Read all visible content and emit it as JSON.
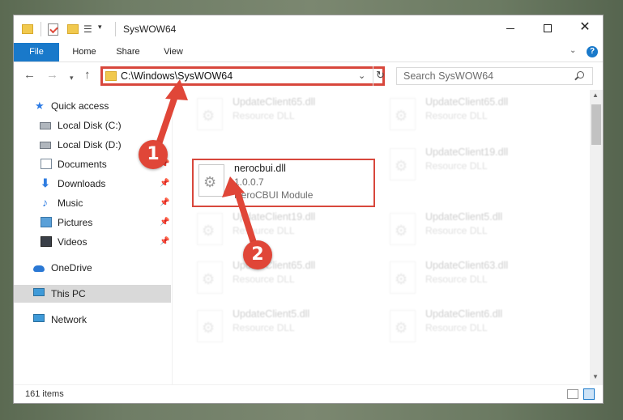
{
  "window": {
    "title": "SysWOW64",
    "controls": {
      "minimize": "minimize",
      "maximize": "maximize",
      "close": "✕"
    }
  },
  "ribbon": {
    "tabs": [
      "File",
      "Home",
      "Share",
      "View"
    ],
    "chevron": "⌄",
    "help": "?"
  },
  "nav": {
    "address": "C:\\Windows\\SysWOW64",
    "search_placeholder": "Search SysWOW64",
    "refresh": "↻",
    "dropdown": "⌄"
  },
  "sidebar": {
    "items": [
      {
        "label": "Quick access",
        "icon": "star-icon",
        "pinned": false
      },
      {
        "label": "Local Disk (C:)",
        "icon": "disk-icon",
        "pinned": false
      },
      {
        "label": "Local Disk (D:)",
        "icon": "disk-icon",
        "pinned": false
      },
      {
        "label": "Documents",
        "icon": "documents-icon",
        "pinned": true
      },
      {
        "label": "Downloads",
        "icon": "downloads-icon",
        "pinned": true
      },
      {
        "label": "Music",
        "icon": "music-icon",
        "pinned": true
      },
      {
        "label": "Pictures",
        "icon": "pictures-icon",
        "pinned": true
      },
      {
        "label": "Videos",
        "icon": "videos-icon",
        "pinned": true
      },
      {
        "label": "OneDrive",
        "icon": "onedrive-icon",
        "pinned": false
      },
      {
        "label": "This PC",
        "icon": "this-pc-icon",
        "pinned": false,
        "selected": true
      },
      {
        "label": "Network",
        "icon": "network-icon",
        "pinned": false
      }
    ]
  },
  "files": {
    "focused": {
      "name": "nerocbui.dll",
      "version": "1.0.0.7",
      "description": "NeroCBUI Module"
    },
    "blurred": [
      {
        "name": "UpdateClient65.dll",
        "type": "Resource DLL"
      },
      {
        "name": "UpdateClient65.dll",
        "type": "Resource DLL"
      },
      {
        "name": "UpdateClient19.dll",
        "type": "Resource DLL"
      },
      {
        "name": "UpdateClient19.dll",
        "type": "Resource DLL"
      },
      {
        "name": "UpdateClient5.dll",
        "type": "Resource DLL"
      },
      {
        "name": "UpdateClient65.dll",
        "type": "Resource DLL"
      },
      {
        "name": "UpdateClient63.dll",
        "type": "Resource DLL"
      },
      {
        "name": "UpdateClient5.dll",
        "type": "Resource DLL"
      },
      {
        "name": "UpdateClient6.dll",
        "type": "Resource DLL"
      }
    ]
  },
  "status": {
    "item_count": "161 items"
  },
  "annotations": {
    "step1": "1",
    "step2": "2",
    "color": "#e04638"
  },
  "colors": {
    "accent": "#1979ca",
    "highlight_border": "#d8473c",
    "folder": "#f1c94e"
  }
}
